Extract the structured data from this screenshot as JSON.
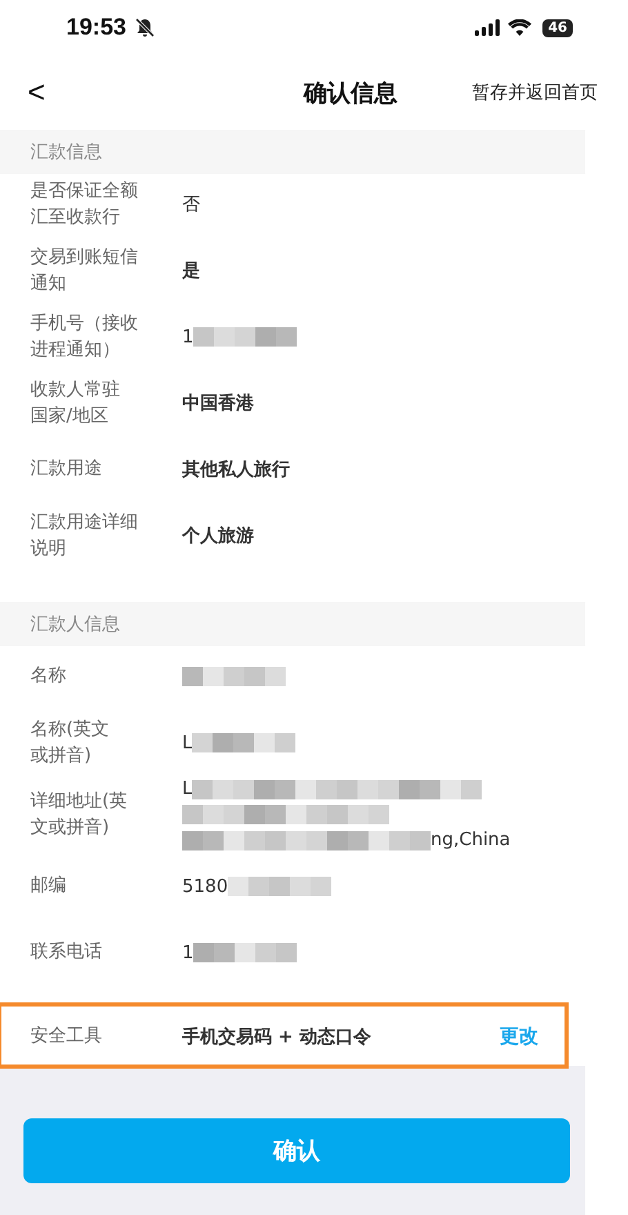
{
  "status_bar": {
    "time": "19:53",
    "battery": "46"
  },
  "nav": {
    "back": "<",
    "title": "确认信息",
    "action": "暂存并返回首页"
  },
  "sections": [
    {
      "title": "汇款信息",
      "rows": [
        {
          "label": [
            "是否保证全额",
            "汇至收款行"
          ],
          "value": "否",
          "bold": false,
          "redacted": false
        },
        {
          "label": [
            "交易到账短信",
            "通知"
          ],
          "value": "是",
          "bold": true,
          "redacted": false
        },
        {
          "label": [
            "手机号（接收",
            "进程通知）"
          ],
          "value": "1",
          "bold": false,
          "redacted": true
        },
        {
          "label": [
            "收款人常驻",
            "国家/地区"
          ],
          "value": "中国香港",
          "bold": true,
          "redacted": false
        },
        {
          "label": [
            "汇款用途"
          ],
          "value": "其他私人旅行",
          "bold": true,
          "redacted": false
        },
        {
          "label": [
            "汇款用途详细",
            "说明"
          ],
          "value": "个人旅游",
          "bold": true,
          "redacted": false
        }
      ]
    },
    {
      "title": "汇款人信息",
      "rows": [
        {
          "label": [
            "名称"
          ],
          "redacted": true
        },
        {
          "label": [
            "名称(英文",
            "或拼音)"
          ],
          "value": "L",
          "bold": false,
          "redacted": true
        },
        {
          "label": [
            "详细地址(英",
            "文或拼音)"
          ],
          "value": "L",
          "tail": "ng,China",
          "bold": false,
          "redacted": true
        },
        {
          "label": [
            "邮编"
          ],
          "value": "5180",
          "bold": false,
          "redacted": true
        },
        {
          "label": [
            "联系电话"
          ],
          "value": "1",
          "bold": false,
          "redacted": true
        }
      ]
    }
  ],
  "security": {
    "label": "安全工具",
    "value": "手机交易码 + 动态口令",
    "action": "更改",
    "highlighted": true
  },
  "confirm_button": "确认"
}
